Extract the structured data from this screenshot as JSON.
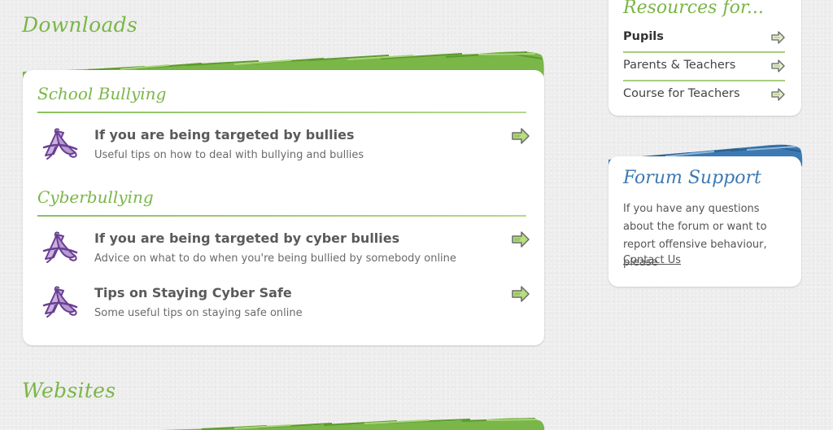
{
  "downloads": {
    "heading": "Downloads",
    "categories": [
      {
        "title": "School Bullying",
        "items": [
          {
            "title": "If you are being targeted by bullies",
            "description": "Useful tips on how to deal with bullying and bullies"
          }
        ]
      },
      {
        "title": "Cyberbullying",
        "items": [
          {
            "title": "If you are being targeted by cyber bullies",
            "description": "Advice on what to do when you're being bullied by somebody online"
          },
          {
            "title": "Tips on Staying Cyber Safe",
            "description": "Some useful tips on staying safe online"
          }
        ]
      }
    ]
  },
  "websites": {
    "heading": "Websites"
  },
  "sidebar": {
    "resources": {
      "title": "Resources for...",
      "links": [
        {
          "label": "Pupils",
          "active": true
        },
        {
          "label": "Parents & Teachers",
          "active": false
        },
        {
          "label": "Course for Teachers",
          "active": false
        }
      ]
    },
    "forum": {
      "title": "Forum Support",
      "text": "If you have any questions about the forum or want to report offensive behaviour, please",
      "link_label": "Contact Us"
    }
  },
  "colors": {
    "accent_green": "#7ab648",
    "accent_blue": "#3d7ab3",
    "icon_purple": "#7a4fa0"
  },
  "icons": {
    "download_item": "pdf-document-icon",
    "item_arrow": "arrow-right-icon"
  }
}
